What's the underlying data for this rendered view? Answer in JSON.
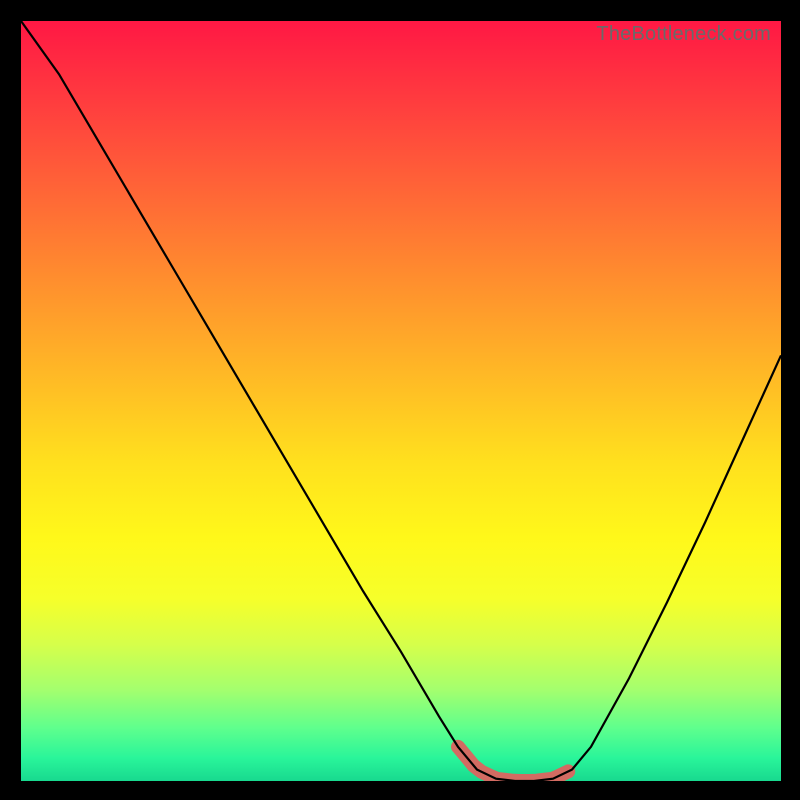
{
  "attribution": "TheBottleneck.com",
  "chart_data": {
    "type": "line",
    "title": "",
    "xlabel": "",
    "ylabel": "",
    "xlim": [
      0,
      1
    ],
    "ylim": [
      0,
      1
    ],
    "x": [
      0.0,
      0.05,
      0.1,
      0.15,
      0.2,
      0.25,
      0.3,
      0.35,
      0.4,
      0.45,
      0.5,
      0.55,
      0.575,
      0.6,
      0.625,
      0.65,
      0.675,
      0.7,
      0.725,
      0.75,
      0.8,
      0.85,
      0.9,
      0.95,
      1.0
    ],
    "values": [
      1.0,
      0.93,
      0.845,
      0.76,
      0.675,
      0.59,
      0.505,
      0.42,
      0.335,
      0.25,
      0.17,
      0.085,
      0.045,
      0.015,
      0.003,
      0.0,
      0.0,
      0.003,
      0.015,
      0.045,
      0.135,
      0.235,
      0.34,
      0.45,
      0.56
    ],
    "highlight_band_x": [
      0.575,
      0.72
    ],
    "colors": {
      "gradient_top": "#ff1844",
      "gradient_mid": "#ffe01e",
      "gradient_bottom": "#18d98f",
      "curve": "#000000",
      "band": "#d36b62"
    }
  }
}
